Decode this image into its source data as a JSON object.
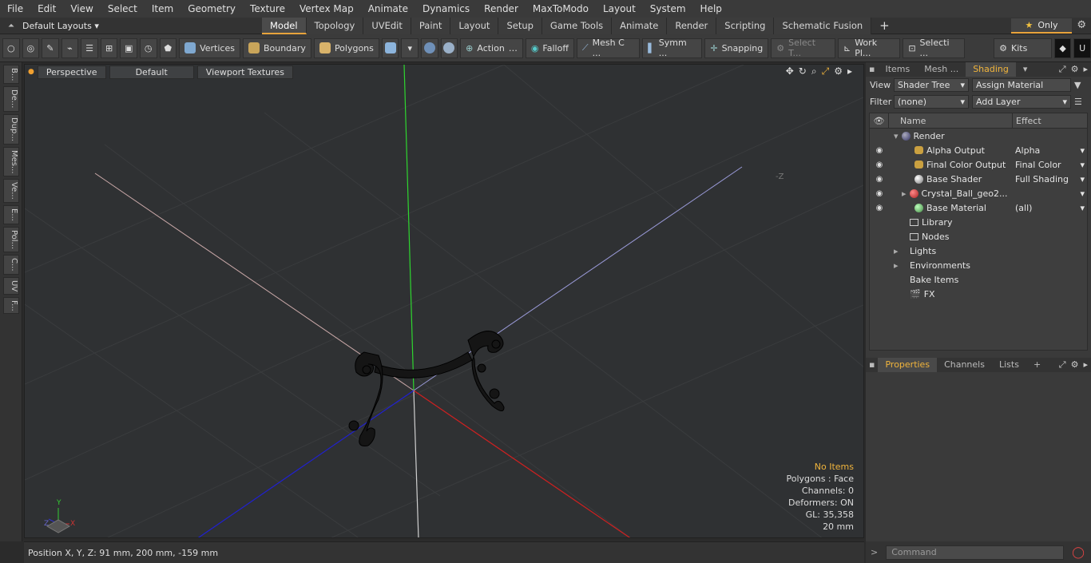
{
  "menu": [
    "File",
    "Edit",
    "View",
    "Select",
    "Item",
    "Geometry",
    "Texture",
    "Vertex Map",
    "Animate",
    "Dynamics",
    "Render",
    "MaxToModo",
    "Layout",
    "System",
    "Help"
  ],
  "layout_select": "Default Layouts",
  "tabs": [
    "Model",
    "Topology",
    "UVEdit",
    "Paint",
    "Layout",
    "Setup",
    "Game Tools",
    "Animate",
    "Render",
    "Scripting",
    "Schematic Fusion"
  ],
  "active_tab": "Model",
  "only_label": "Only",
  "toolbar": {
    "vertices": "Vertices",
    "boundary": "Boundary",
    "polygons": "Polygons",
    "action": "Action",
    "falloff": "Falloff",
    "mesh_c": "Mesh C ...",
    "symm": "Symm ...",
    "snapping": "Snapping",
    "select_t": "Select T...",
    "work_pl": "Work Pl...",
    "selecti": "Selecti ...",
    "kits": "Kits"
  },
  "left_tabs": [
    "B...",
    "De...",
    "Dup...",
    "Mes...",
    "Ve...",
    "E...",
    "Pol...",
    "C...",
    "UV",
    "F..."
  ],
  "viewport": {
    "perspective": "Perspective",
    "default": "Default",
    "textures": "Viewport Textures",
    "stats": {
      "no_items": "No Items",
      "polygons": "Polygons : Face",
      "channels": "Channels: 0",
      "deformers": "Deformers: ON",
      "gl": "GL: 35,358",
      "scale": "20 mm"
    },
    "axis_z_label": "-Z"
  },
  "status": {
    "position": "Position X, Y, Z:   91 mm, 200 mm, -159 mm"
  },
  "right_panel": {
    "tabs": [
      "Items",
      "Mesh ...",
      "Shading"
    ],
    "active_tab": "Shading",
    "view_label": "View",
    "view_value": "Shader Tree",
    "assign": "Assign Material",
    "filter_label": "Filter",
    "filter_value": "(none)",
    "add_layer": "Add Layer",
    "col_name": "Name",
    "col_effect": "Effect",
    "rows": [
      {
        "name": "Render",
        "effect": "",
        "indent": 0,
        "icon": "render-ball-icon"
      },
      {
        "name": "Alpha Output",
        "effect": "Alpha",
        "indent": 1,
        "icon": "output-icon"
      },
      {
        "name": "Final Color Output",
        "effect": "Final Color",
        "indent": 1,
        "icon": "output-icon"
      },
      {
        "name": "Base Shader",
        "effect": "Full Shading",
        "indent": 1,
        "icon": "shader-ball-icon"
      },
      {
        "name": "Crystal_Ball_geo2...",
        "effect": "",
        "indent": 1,
        "icon": "material-group-icon"
      },
      {
        "name": "Base Material",
        "effect": "(all)",
        "indent": 1,
        "icon": "material-ball-icon"
      },
      {
        "name": "Library",
        "effect": "",
        "indent": 0,
        "icon": "folder-icon"
      },
      {
        "name": "Nodes",
        "effect": "",
        "indent": 0,
        "icon": "folder-icon"
      },
      {
        "name": "Lights",
        "effect": "",
        "indent": 0,
        "icon": ""
      },
      {
        "name": "Environments",
        "effect": "",
        "indent": 0,
        "icon": ""
      },
      {
        "name": "Bake Items",
        "effect": "",
        "indent": 0,
        "icon": ""
      },
      {
        "name": "FX",
        "effect": "",
        "indent": 0,
        "icon": "fx-icon"
      }
    ],
    "bottom_tabs": [
      "Properties",
      "Channels",
      "Lists"
    ],
    "bottom_active": "Properties",
    "command_placeholder": "Command"
  }
}
